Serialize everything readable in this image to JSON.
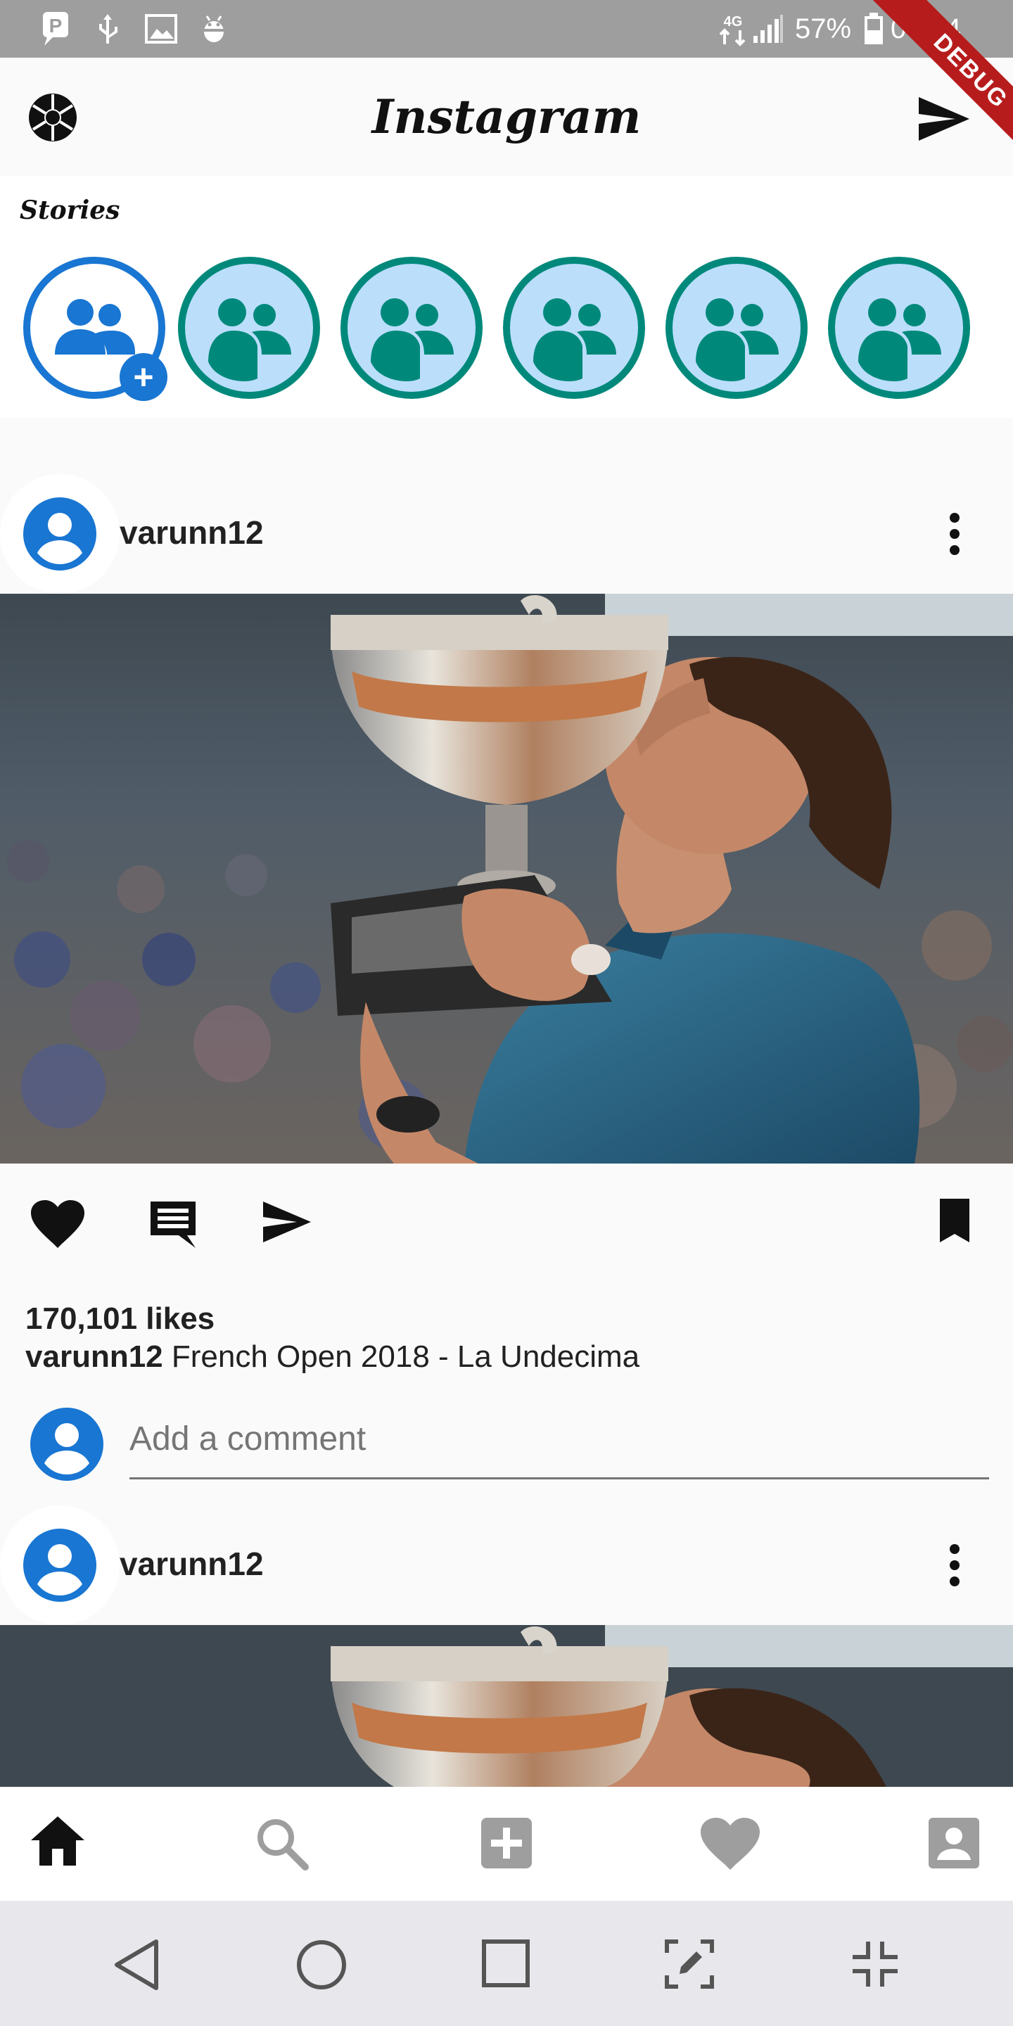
{
  "status_bar": {
    "battery": "57%",
    "time": "04:04",
    "network": "4G",
    "icons": [
      "p-notification-icon",
      "usb-icon",
      "image-icon",
      "android-debug-icon",
      "signal-icon",
      "battery-icon"
    ],
    "background": "#9e9e9e"
  },
  "debug_banner": "DEBUG",
  "app_bar": {
    "title": "Instagram",
    "left_icon": "camera-aperture-icon",
    "right_icon": "send-icon"
  },
  "stories": {
    "label": "Stories",
    "items": [
      {
        "type": "own",
        "badge": "+"
      },
      {
        "type": "friend"
      },
      {
        "type": "friend"
      },
      {
        "type": "friend"
      },
      {
        "type": "friend"
      },
      {
        "type": "friend"
      }
    ],
    "ring_color_own": "#1976d2",
    "ring_color_friend": "#00897b"
  },
  "posts": [
    {
      "username": "varunn12",
      "likes": "170,101 likes",
      "caption_user": "varunn12",
      "caption_text": "French Open 2018 - La Undecima",
      "comment_placeholder": "Add a comment"
    },
    {
      "username": "varunn12"
    }
  ],
  "post_actions": [
    "heart-icon",
    "comment-icon",
    "send-icon",
    "bookmark-icon"
  ],
  "bottom_nav": {
    "items": [
      "home-icon",
      "search-icon",
      "add-box-icon",
      "heart-icon",
      "account-box-icon"
    ],
    "active": "home-icon"
  },
  "system_nav": [
    "back-icon",
    "home-circle-icon",
    "recents-icon",
    "screenshot-edit-icon",
    "collapse-icon"
  ],
  "colors": {
    "accent_blue": "#1976d2",
    "teal": "#00897b",
    "light_blue": "#bbdefb"
  }
}
